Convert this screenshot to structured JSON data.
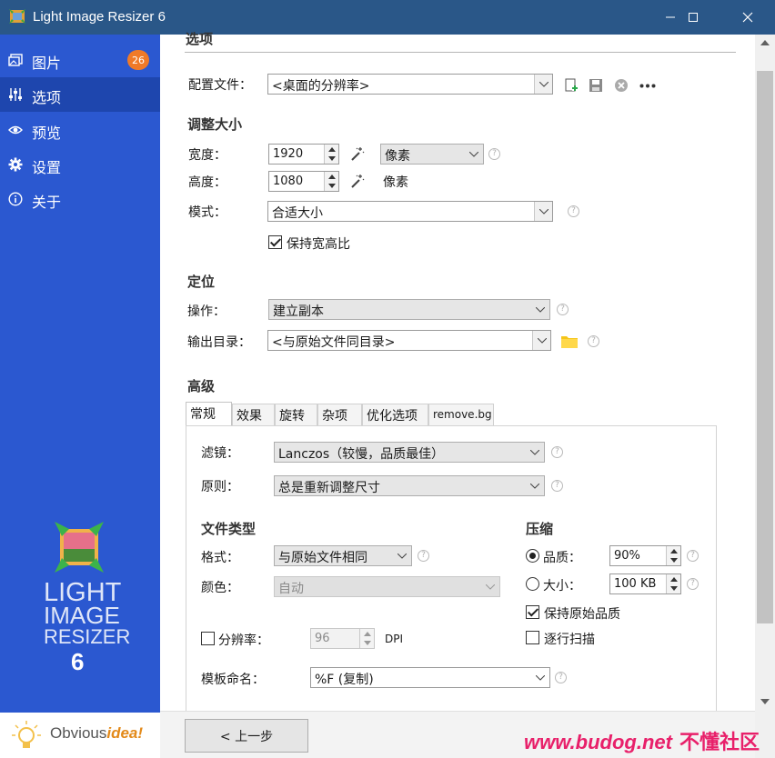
{
  "window": {
    "title": "Light Image Resizer 6",
    "controls": {
      "minimize": "—",
      "maximize": "☐",
      "close": "✕"
    }
  },
  "sidebar": {
    "items": [
      {
        "label": "图片",
        "icon": "images-icon",
        "badge": "26"
      },
      {
        "label": "选项",
        "icon": "sliders-icon",
        "active": true
      },
      {
        "label": "预览",
        "icon": "eye-icon"
      },
      {
        "label": "设置",
        "icon": "gear-icon"
      },
      {
        "label": "关于",
        "icon": "info-icon"
      }
    ],
    "logo": {
      "line1": "LIGHT",
      "line2": "IMAGE",
      "line3": "RESIZER",
      "line4": "6"
    },
    "vendor": {
      "name_part1": "Obvious",
      "name_part2": "idea!"
    }
  },
  "options": {
    "section_title": "选项",
    "profile": {
      "label": "配置文件：",
      "value": "<桌面的分辨率>"
    },
    "resize": {
      "heading": "调整大小",
      "width_label": "宽度：",
      "width_value": "1920",
      "unit_value": "像素",
      "height_label": "高度：",
      "height_value": "1080",
      "height_unit": "像素",
      "mode_label": "模式：",
      "mode_value": "合适大小",
      "keep_ratio_label": "保持宽高比",
      "keep_ratio_checked": true
    },
    "target": {
      "heading": "定位",
      "action_label": "操作：",
      "action_value": "建立副本",
      "output_label": "输出目录：",
      "output_value": "<与原始文件同目录>"
    },
    "advanced": {
      "heading": "高级",
      "tabs": [
        "常规",
        "效果",
        "旋转",
        "杂项",
        "优化选项",
        "remove.bg"
      ],
      "active_tab": "常规",
      "filter_label": "滤镜：",
      "filter_value": "Lanczos（较慢，品质最佳）",
      "rule_label": "原则：",
      "rule_value": "总是重新调整尺寸",
      "filetype_heading": "文件类型",
      "format_label": "格式：",
      "format_value": "与原始文件相同",
      "color_label": "颜色：",
      "color_value": "自动",
      "resolution_label": "分辨率：",
      "resolution_value": "96",
      "resolution_unit": "DPI",
      "resolution_checked": false,
      "template_label": "模板命名：",
      "template_value": "%F (复制)",
      "compression_heading": "压缩",
      "quality_label": "品质：",
      "quality_value": "90%",
      "quality_selected": true,
      "size_label": "大小：",
      "size_value": "100 KB",
      "keep_quality_label": "保持原始品质",
      "keep_quality_checked": true,
      "progressive_label": "逐行扫描",
      "progressive_checked": false
    }
  },
  "footer": {
    "prev_button": "< 上一步",
    "watermark_url": "www.budog.net",
    "watermark_text": "不懂社区"
  },
  "colors": {
    "titlebar": "#2a5788",
    "sidebar": "#2b58d0",
    "sidebar_active": "#1e46ae",
    "badge": "#f07a28",
    "watermark": "#e8206a"
  }
}
